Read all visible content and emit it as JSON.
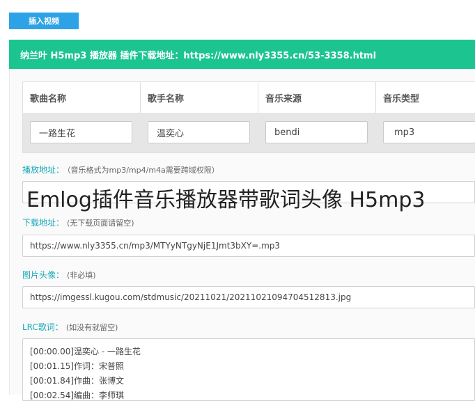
{
  "insert_button": "插入视频",
  "panel_title": "纳兰叶 H5mp3 播放器 插件下载地址：https://www.nly3355.cn/53-3358.html",
  "table": {
    "headers": [
      "歌曲名称",
      "歌手名称",
      "音乐来源",
      "音乐类型"
    ],
    "values": [
      "一路生花",
      "温奕心",
      "bendi",
      "mp3"
    ]
  },
  "play_url": {
    "label": "播放地址：",
    "hint": "（音乐格式为mp3/mp4/m4a需要跨域权限）"
  },
  "overlay_title": "Emlog插件音乐播放器带歌词头像 H5mp3",
  "download_url": {
    "label": "下载地址：",
    "hint": "(无下载页面请留空)",
    "value": "https://www.nly3355.cn/mp3/MTYyNTgyNjE1Jmt3bXY=.mp3"
  },
  "cover": {
    "label": "图片头像：",
    "hint": "(非必填)",
    "value": "https://imgessl.kugou.com/stdmusic/20211021/20211021094704512813.jpg"
  },
  "lrc": {
    "label": "LRC歌词：",
    "hint": "(如没有就留空)",
    "lines": [
      "[00:00.00]温奕心 - 一路生花",
      "[00:01.15]作词：宋普照",
      "[00:01.84]作曲：张博文",
      "[00:02.54]编曲：李师琪"
    ]
  }
}
